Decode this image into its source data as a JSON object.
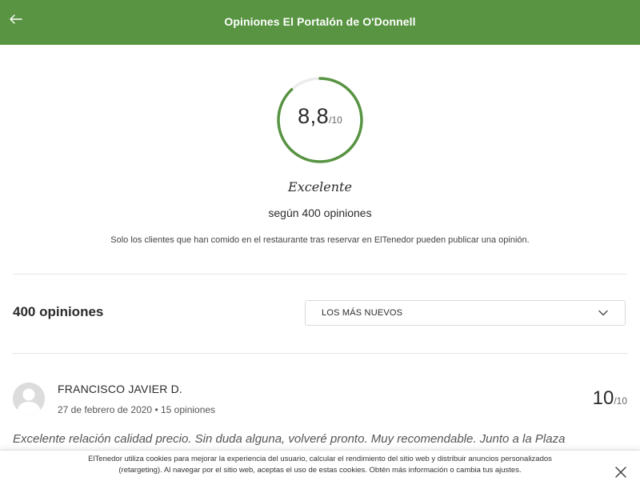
{
  "header": {
    "title": "Opiniones El Portalón de O'Donnell",
    "back_icon": "arrow-left-icon"
  },
  "rating": {
    "score": "8,8",
    "scale": "/10",
    "score_value": 8.8,
    "max_value": 10,
    "label": "Excelente",
    "count_text": "según 400 opiniones",
    "disclaimer": "Solo los clientes que han comido en el restaurante tras reservar en ElTenedor pueden publicar una opinión."
  },
  "reviews": {
    "count_label": "400 opiniones",
    "sort_selected": "LOS MÁS NUEVOS",
    "items": [
      {
        "name": "FRANCISCO JAVIER D.",
        "date": "27 de febrero de 2020",
        "opinions": "15 opiniones",
        "score": "10",
        "scale": "/10",
        "text": "Excelente relación calidad precio. Sin duda alguna, volveré pronto. Muy recomendable. Junto a la Plaza"
      }
    ]
  },
  "cookie": {
    "line1": "ElTenedor utiliza cookies para mejorar la experiencia del usuario, calcular el rendimiento del sitio web y distribuir anuncios personalizados",
    "line2": "(retargeting). Al navegar por el sitio web, aceptas el uso de estas cookies. Obtén más información o cambia tus ajustes."
  },
  "colors": {
    "brand_green": "#589442",
    "ring_track": "#ececec"
  }
}
